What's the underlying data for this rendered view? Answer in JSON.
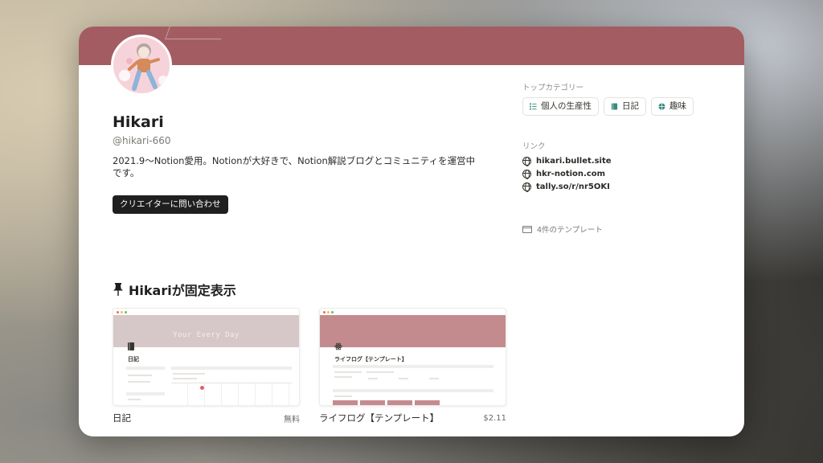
{
  "profile": {
    "name": "Hikari",
    "handle": "@hikari-660",
    "bio": "2021.9〜Notion愛用。Notionが大好きで、Notion解説ブログとコミュニティを運営中です。",
    "contact_button": "クリエイターに問い合わせ",
    "banner_color": "#a35d62"
  },
  "sidebar": {
    "categories_label": "トップカテゴリー",
    "categories": [
      {
        "label": "個人の生産性",
        "icon": "checklist-icon"
      },
      {
        "label": "日記",
        "icon": "book-icon"
      },
      {
        "label": "趣味",
        "icon": "ball-icon"
      }
    ],
    "links_label": "リンク",
    "links": [
      {
        "label": "hikari.bullet.site",
        "icon": "globe-icon"
      },
      {
        "label": "hkr-notion.com",
        "icon": "globe-icon"
      },
      {
        "label": "tally.so/r/nr5OKI",
        "icon": "globe-icon"
      }
    ],
    "templates_count": "4件のテンプレート"
  },
  "pinned": {
    "title": "Hikariが固定表示",
    "templates": [
      {
        "name": "日記",
        "price": "無料",
        "cover_text": "Your Every Day",
        "page_title": "日記",
        "cover_color": "#d6c7c8"
      },
      {
        "name": "ライフログ【テンプレート】",
        "price": "$2.11",
        "page_title": "ライフログ【テンプレート】",
        "cover_color": "#c48b8f"
      }
    ]
  }
}
